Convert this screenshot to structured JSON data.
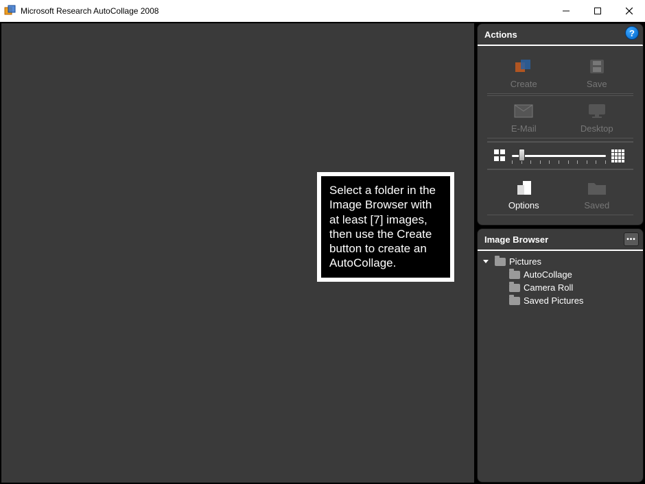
{
  "window": {
    "title": "Microsoft Research AutoCollage 2008"
  },
  "hint": "Select a folder in the Image Browser with at least [7] images, then use the Create button to create an AutoCollage.",
  "actions": {
    "title": "Actions",
    "create": "Create",
    "save": "Save",
    "email": "E-Mail",
    "desktop": "Desktop",
    "options": "Options",
    "saved": "Saved"
  },
  "browser": {
    "title": "Image Browser",
    "root": "Pictures",
    "children": [
      "AutoCollage",
      "Camera Roll",
      "Saved Pictures"
    ]
  }
}
